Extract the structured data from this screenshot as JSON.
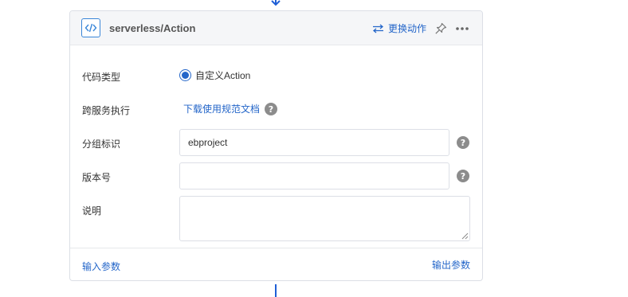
{
  "card": {
    "title": "serverless/Action",
    "change_action_label": "更换动作"
  },
  "form": {
    "code_type_label": "代码类型",
    "code_type_option": "自定义Action",
    "cross_service_label": "跨服务执行",
    "doc_link": "下载使用规范文档",
    "group_id_label": "分组标识",
    "group_id_value": "ebproject",
    "version_label": "版本号",
    "version_value": "",
    "description_label": "说明",
    "description_value": ""
  },
  "footer": {
    "input_params": "输入参数",
    "output_params": "输出参数"
  },
  "help_glyph": "?",
  "icons": {
    "header": "code-brackets-icon",
    "change": "swap-arrows-icon",
    "pin": "pin-icon",
    "more": "more-horizontal-icon",
    "connector": "arrow-down-icon",
    "help": "question-circle-icon"
  },
  "colors": {
    "accent": "#2466c9",
    "border": "#dcdfe6",
    "header_bg": "#f5f6f8",
    "help_bg": "#8c8c8c"
  }
}
